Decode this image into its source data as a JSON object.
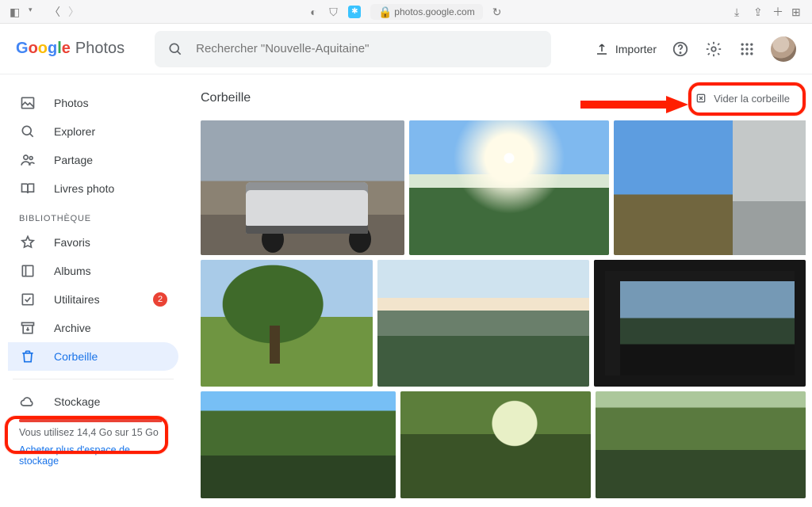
{
  "browser": {
    "url": "photos.google.com"
  },
  "logo": {
    "word": "Photos"
  },
  "search": {
    "placeholder": "Rechercher \"Nouvelle-Aquitaine\""
  },
  "header": {
    "import": "Importer"
  },
  "sidebar": {
    "items": [
      {
        "label": "Photos"
      },
      {
        "label": "Explorer"
      },
      {
        "label": "Partage"
      },
      {
        "label": "Livres photo"
      }
    ],
    "section_label": "BIBLIOTHÈQUE",
    "library": [
      {
        "label": "Favoris"
      },
      {
        "label": "Albums"
      },
      {
        "label": "Utilitaires",
        "badge": "2"
      },
      {
        "label": "Archive"
      },
      {
        "label": "Corbeille",
        "active": true
      }
    ]
  },
  "storage": {
    "title": "Stockage",
    "usage": "Vous utilisez 14,4 Go sur 15 Go",
    "buy": "Acheter plus d'espace de stockage"
  },
  "main": {
    "title": "Corbeille",
    "empty_button": "Vider la corbeille"
  }
}
